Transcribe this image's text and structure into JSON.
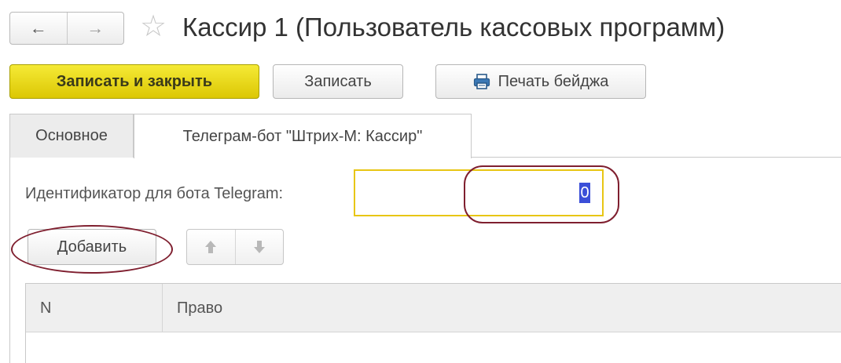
{
  "header": {
    "title": "Кассир 1 (Пользователь кассовых программ)",
    "nav": {
      "back_glyph": "←",
      "forward_glyph": "→"
    },
    "favorite_glyph": "☆"
  },
  "toolbar": {
    "save_close_label": "Записать и закрыть",
    "save_label": "Записать",
    "print_label": "Печать бейджа"
  },
  "tabs": [
    {
      "label": "Основное",
      "active": false
    },
    {
      "label": "Телеграм-бот \"Штрих-М: Кассир\"",
      "active": true
    }
  ],
  "form": {
    "telegram_id_label": "Идентификатор для бота Telegram:",
    "telegram_id_value": "0"
  },
  "table_toolbar": {
    "add_label": "Добавить",
    "up_glyph": "🡅",
    "down_glyph": "🡇"
  },
  "table": {
    "columns": [
      "N",
      "Право"
    ]
  },
  "colors": {
    "primary_button": "#e9d71b",
    "field_focus_border": "#e8c614",
    "annotation": "#7f1f2f",
    "selection": "#3b4fd8"
  },
  "icons": [
    "back-arrow-icon",
    "forward-arrow-icon",
    "star-icon",
    "printer-icon",
    "arrow-up-icon",
    "arrow-down-icon"
  ]
}
